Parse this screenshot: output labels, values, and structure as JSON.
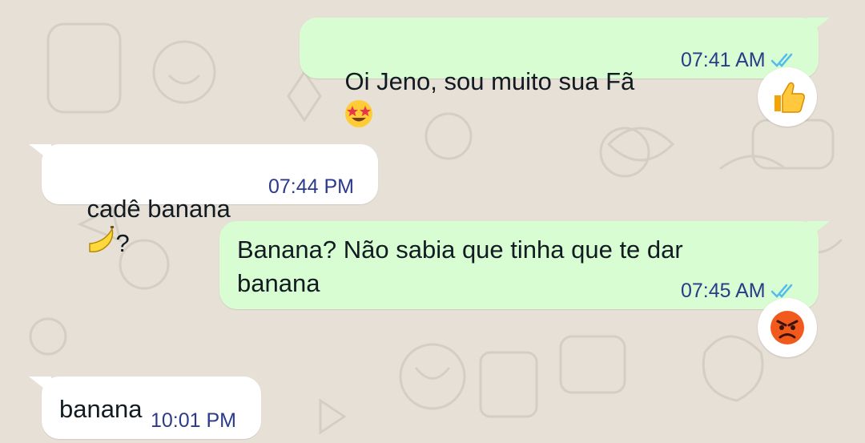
{
  "chat": {
    "messages": [
      {
        "direction": "outgoing",
        "text": "Oi Jeno, sou muito sua Fã",
        "emoji": "star-struck",
        "time": "07:41 AM",
        "status": "read",
        "reaction": "thumbs-up"
      },
      {
        "direction": "incoming",
        "text": "cadê banana",
        "emoji": "banana",
        "suffix": "?",
        "time": "07:44 PM"
      },
      {
        "direction": "outgoing",
        "line1": "Banana? Não sabia que tinha que te dar",
        "line2": "banana",
        "time": "07:45 AM",
        "status": "read",
        "reaction": "angry-face"
      },
      {
        "direction": "incoming",
        "text": "banana",
        "time": "10:01 PM"
      }
    ]
  },
  "colors": {
    "background": "#e7e0d6",
    "outgoing_bubble": "#d9fdd3",
    "incoming_bubble": "#ffffff",
    "timestamp": "#2c3a8a",
    "read_ticks": "#53bdeb"
  }
}
